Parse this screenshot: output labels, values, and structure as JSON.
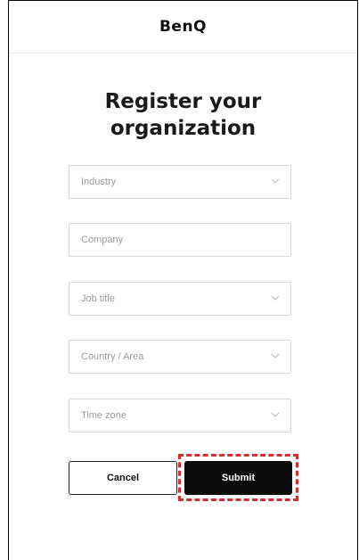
{
  "header": {
    "logo": "BenQ"
  },
  "page": {
    "title_line1": "Register your",
    "title_line2": "organization"
  },
  "form": {
    "industry_placeholder": "Industry",
    "company_placeholder": "Company",
    "job_title_placeholder": "Job title",
    "country_placeholder": "Country / Area",
    "timezone_placeholder": "Time zone"
  },
  "actions": {
    "cancel_label": "Cancel",
    "submit_label": "Submit"
  },
  "icons": {
    "dropdown": "chevron-down-icon"
  },
  "colors": {
    "primary_button": "#0a0a0a",
    "highlight": "#d32f2f",
    "field_border": "#d9d9d9",
    "placeholder_text": "#9a9a9a"
  }
}
